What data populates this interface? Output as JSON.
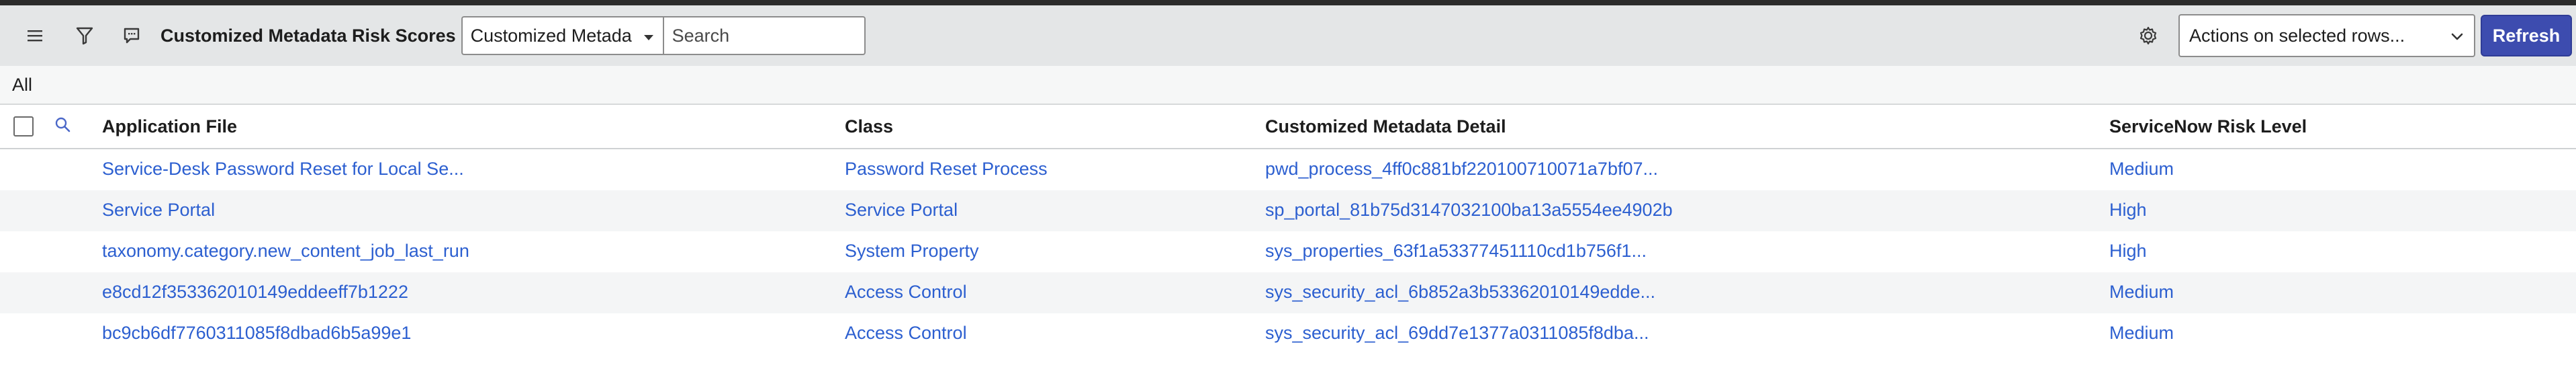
{
  "header": {
    "title": "Customized Metadata Risk Scores",
    "field_select": "Customized Metada",
    "search_placeholder": "Search",
    "actions_select": "Actions on selected rows...",
    "refresh_label": "Refresh",
    "icons": [
      "menu-icon",
      "filter-icon",
      "chat-icon",
      "gear-icon",
      "chevron-down-icon"
    ]
  },
  "breadcrumb": "All",
  "table": {
    "columns": [
      "Application File",
      "Class",
      "Customized Metadata Detail",
      "ServiceNow Risk Level"
    ],
    "rows": [
      [
        "Service-Desk Password Reset for Local Se...",
        "Password Reset Process",
        "pwd_process_4ff0c881bf220100710071a7bf07...",
        "Medium"
      ],
      [
        "Service Portal",
        "Service Portal",
        "sp_portal_81b75d3147032100ba13a5554ee4902b",
        "High"
      ],
      [
        "taxonomy.category.new_content_job_last_run",
        "System Property",
        "sys_properties_63f1a53377451110cd1b756f1...",
        "High"
      ],
      [
        "e8cd12f353362010149eddeeff7b1222",
        "Access Control",
        "sys_security_acl_6b852a3b53362010149edde...",
        "Medium"
      ],
      [
        "bc9cb6df7760311085f8dbad6b5a99e1",
        "Access Control",
        "sys_security_acl_69dd7e1377a0311085f8dba...",
        "Medium"
      ]
    ]
  },
  "colors": {
    "link": "#2c5fd0",
    "refresh_bg": "#3d4caf",
    "header_bg": "#e4e6e7"
  }
}
